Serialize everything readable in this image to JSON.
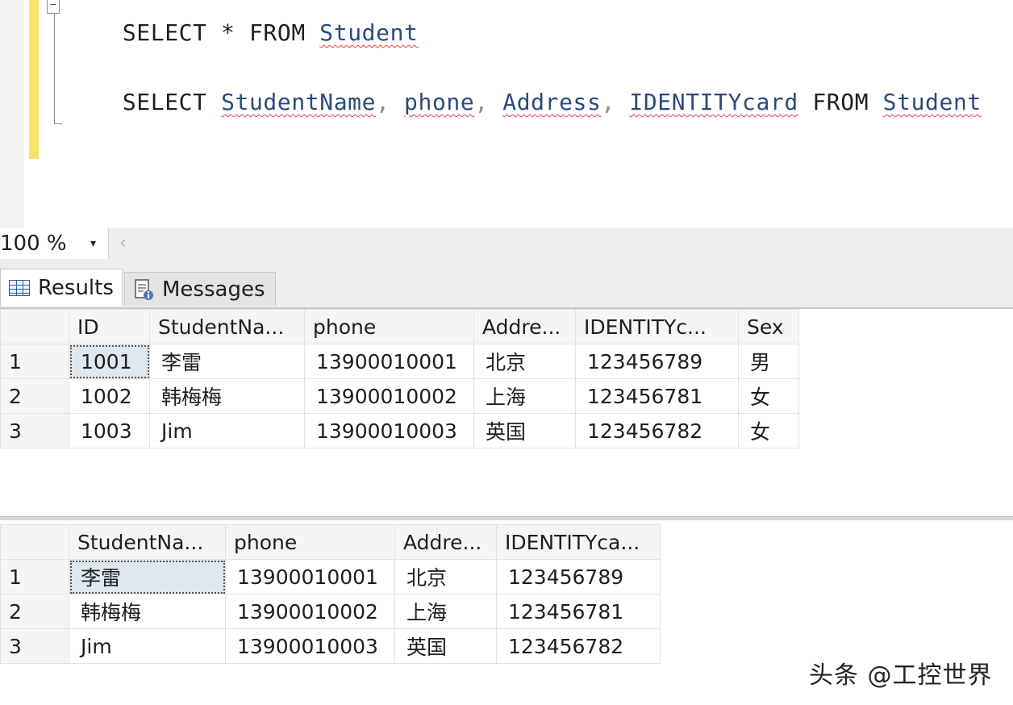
{
  "editor": {
    "line1": [
      "SELECT",
      " * ",
      "FROM",
      " ",
      "Student"
    ],
    "line2": [
      "SELECT",
      " ",
      "StudentName",
      ", ",
      "phone",
      ", ",
      "Address",
      ", ",
      "IDENTITYcard",
      " ",
      "FROM",
      " ",
      "Student"
    ],
    "fold_symbol": "−"
  },
  "zoom": {
    "value": "100 %",
    "dropdown_glyph": "▾",
    "scroll_glyph": "‹"
  },
  "tabs": [
    {
      "label": "Results"
    },
    {
      "label": "Messages"
    }
  ],
  "grid1": {
    "columns": [
      "ID",
      "StudentNa...",
      "phone",
      "Addre...",
      "IDENTITYc...",
      "Sex"
    ],
    "rows": [
      {
        "num": "1",
        "cells": [
          "1001",
          "李雷",
          "13900010001",
          "北京",
          "123456789",
          "男"
        ]
      },
      {
        "num": "2",
        "cells": [
          "1002",
          "韩梅梅",
          "13900010002",
          "上海",
          "123456781",
          "女"
        ]
      },
      {
        "num": "3",
        "cells": [
          "1003",
          "Jim",
          "13900010003",
          "英国",
          "123456782",
          "女"
        ]
      }
    ]
  },
  "grid2": {
    "columns": [
      "StudentNa...",
      "phone",
      "Addre...",
      "IDENTITYca..."
    ],
    "rows": [
      {
        "num": "1",
        "cells": [
          "李雷",
          "13900010001",
          "北京",
          "123456789"
        ]
      },
      {
        "num": "2",
        "cells": [
          "韩梅梅",
          "13900010002",
          "上海",
          "123456781"
        ]
      },
      {
        "num": "3",
        "cells": [
          "Jim",
          "13900010003",
          "英国",
          "123456782"
        ]
      }
    ]
  },
  "watermark": "头条 @工控世界"
}
